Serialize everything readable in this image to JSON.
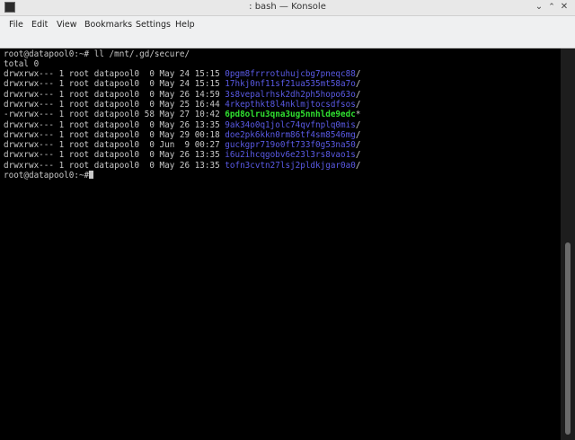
{
  "window": {
    "title": ": bash — Konsole",
    "icons": {
      "app": "terminal-icon",
      "minimize": "chevron-down-icon",
      "maximize": "chevron-up-icon",
      "close": "close-icon"
    }
  },
  "menu": [
    "File",
    "Edit",
    "View",
    "Bookmarks",
    "Settings",
    "Help"
  ],
  "terminal": {
    "prompt": "root@datapool0:~#",
    "command": " ll /mnt/.gd/secure/",
    "total": "total 0",
    "rows": [
      {
        "meta": "drwxrwx--- 1 root datapool0  0 May 24 15:15 ",
        "name": "0pgm8frrrotuhujcbg7pneqc88",
        "suffix": "/",
        "kind": "dir"
      },
      {
        "meta": "drwxrwx--- 1 root datapool0  0 May 24 15:15 ",
        "name": "17hkj0nf11sf21ua535mt58a7o",
        "suffix": "/",
        "kind": "dir"
      },
      {
        "meta": "drwxrwx--- 1 root datapool0  0 May 26 14:59 ",
        "name": "3s8vepalrhsk2dh2ph5hopo63o",
        "suffix": "/",
        "kind": "dir"
      },
      {
        "meta": "drwxrwx--- 1 root datapool0  0 May 25 16:44 ",
        "name": "4rkepthkt8l4nklmjtocsdfsos",
        "suffix": "/",
        "kind": "dir"
      },
      {
        "meta": "-rwxrwx--- 1 root datapool0 58 May 27 10:42 ",
        "name": "6pd8olru3qna3ug5nnhlde9edc",
        "suffix": "*",
        "kind": "exe"
      },
      {
        "meta": "drwxrwx--- 1 root datapool0  0 May 26 13:35 ",
        "name": "9ak34o0q1jolc74qvfnplq0mis",
        "suffix": "/",
        "kind": "dir"
      },
      {
        "meta": "drwxrwx--- 1 root datapool0  0 May 29 00:18 ",
        "name": "doe2pk6kkn0rm86tf4sm8546mg",
        "suffix": "/",
        "kind": "dir"
      },
      {
        "meta": "drwxrwx--- 1 root datapool0  0 Jun  9 00:27 ",
        "name": "guckgpr719o0ft733f0g53na50",
        "suffix": "/",
        "kind": "dir"
      },
      {
        "meta": "drwxrwx--- 1 root datapool0  0 May 26 13:35 ",
        "name": "i6u2ihcqgobv6e23l3rs8vao1s",
        "suffix": "/",
        "kind": "dir"
      },
      {
        "meta": "drwxrwx--- 1 root datapool0  0 May 26 13:35 ",
        "name": "tofn3cvtn27lsj2pldkjgar0a0",
        "suffix": "/",
        "kind": "dir"
      }
    ],
    "final_prompt": "root@datapool0:~#",
    "colors": {
      "background": "#000000",
      "text": "#c8c8c8",
      "directory": "#5a5ae6",
      "executable": "#30e030"
    }
  }
}
